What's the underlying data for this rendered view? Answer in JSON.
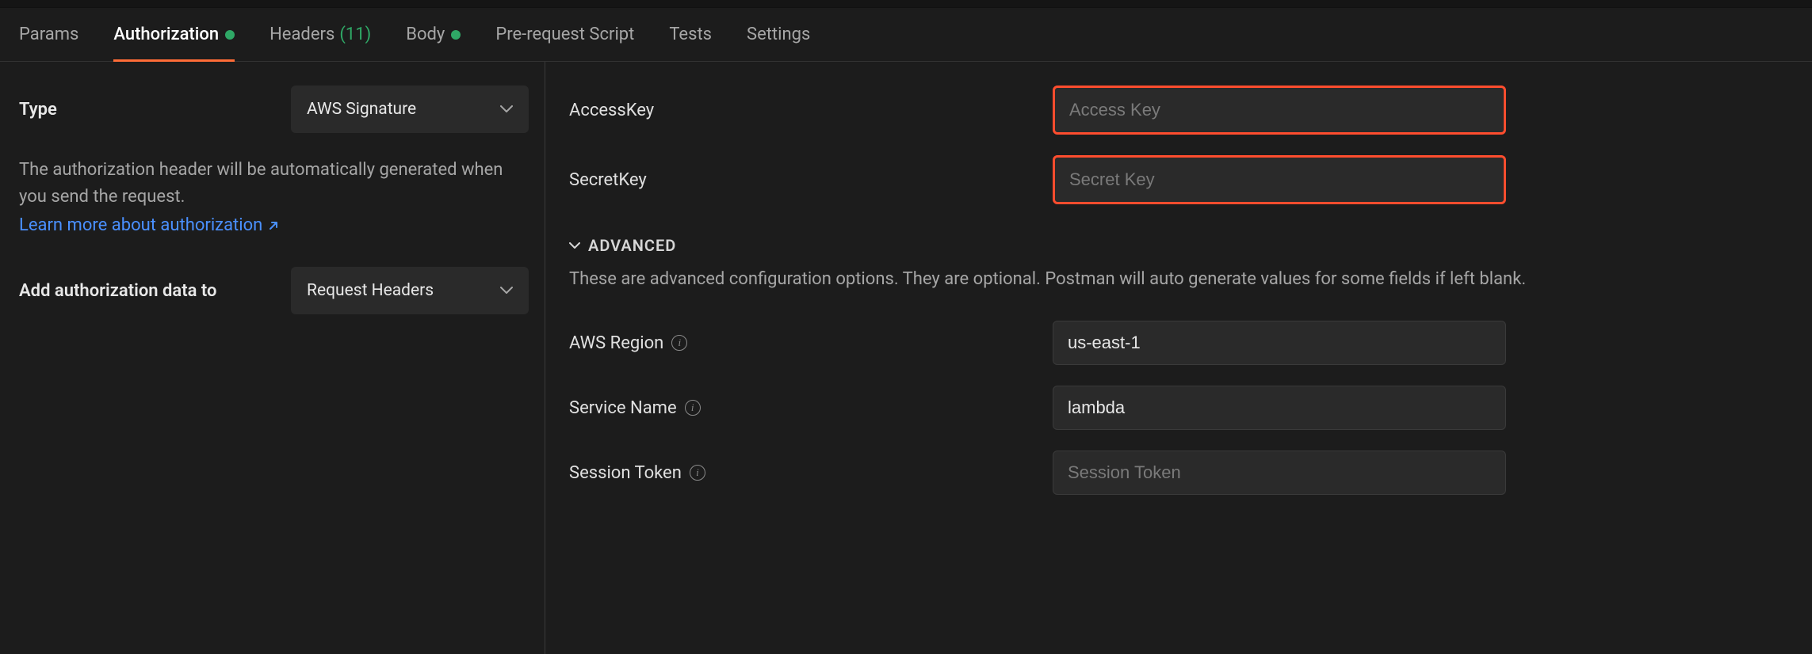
{
  "tabs": {
    "params": "Params",
    "authorization": "Authorization",
    "headers": "Headers",
    "headers_count": "(11)",
    "body": "Body",
    "prerequest": "Pre-request Script",
    "tests": "Tests",
    "settings": "Settings"
  },
  "left": {
    "type_label": "Type",
    "type_value": "AWS Signature",
    "desc": "The authorization header will be automatically generated when you send the request.",
    "learn_link": "Learn more about authorization",
    "add_label": "Add authorization data to",
    "add_value": "Request Headers"
  },
  "right": {
    "access_label": "AccessKey",
    "access_placeholder": "Access Key",
    "access_value": "",
    "secret_label": "SecretKey",
    "secret_placeholder": "Secret Key",
    "secret_value": "",
    "advanced_header": "ADVANCED",
    "advanced_desc": "These are advanced configuration options. They are optional. Postman will auto generate values for some fields if left blank.",
    "region_label": "AWS Region",
    "region_value": "us-east-1",
    "service_label": "Service Name",
    "service_value": "lambda",
    "token_label": "Session Token",
    "token_placeholder": "Session Token",
    "token_value": ""
  }
}
